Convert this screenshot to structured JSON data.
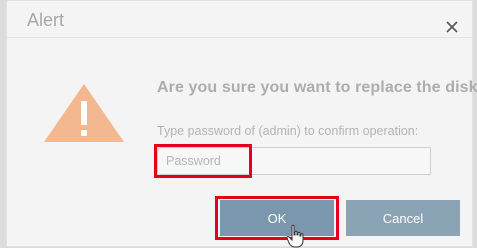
{
  "dialog": {
    "title": "Alert",
    "close_icon": "close-icon",
    "warning_icon": "warning-triangle-icon",
    "question": "Are you sure you want to replace the disk?",
    "prompt": "Type password of (admin) to confirm operation:",
    "password_input": {
      "placeholder": "Password",
      "value": ""
    },
    "buttons": {
      "ok_label": "OK",
      "cancel_label": "Cancel"
    }
  },
  "colors": {
    "dialog_bg": "#f4f4f4",
    "warning_orange": "#f3b88f",
    "ok_button": "#7a97ad",
    "cancel_button": "#8aa3b5",
    "highlight_red": "#e4001b"
  },
  "pointer": "hand-pointer-icon"
}
